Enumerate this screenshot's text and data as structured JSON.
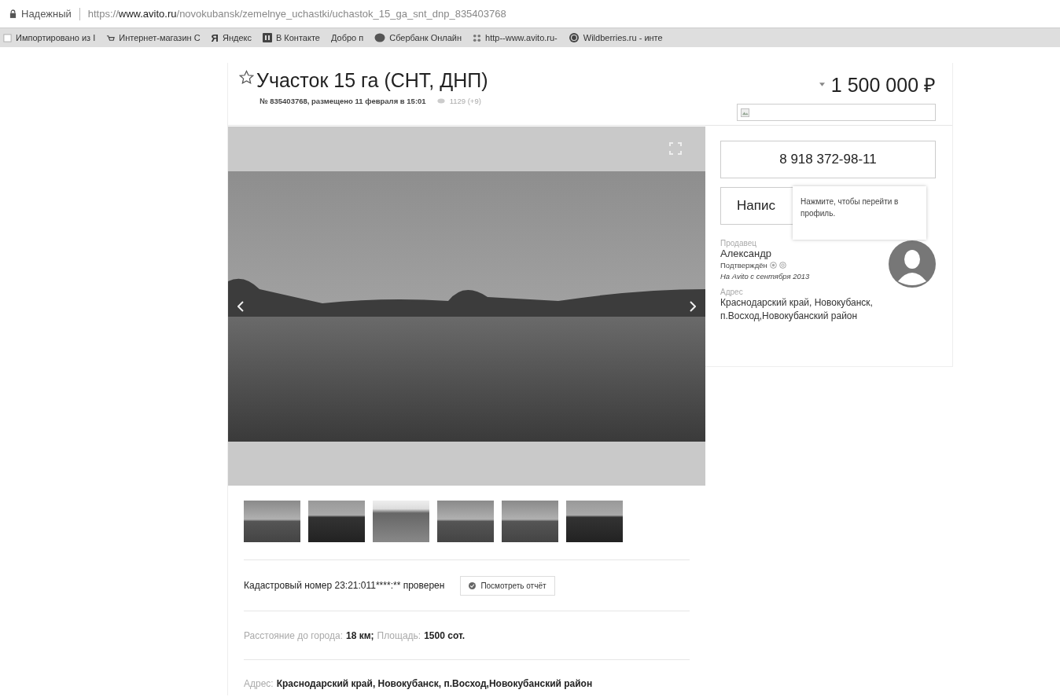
{
  "browser": {
    "security_label": "Надежный",
    "url": {
      "scheme": "https://",
      "host": "www.avito.ru",
      "path": "/novokubansk/zemelnye_uchastki/uchastok_15_ga_snt_dnp_835403768"
    }
  },
  "bookmarks": [
    {
      "kind": "blank",
      "label": "Импортировано из I"
    },
    {
      "kind": "page",
      "label": "Интернет-магазин С"
    },
    {
      "kind": "letter",
      "icon": "Я",
      "label": "Яндекс"
    },
    {
      "kind": "tile",
      "label": "В Контакте"
    },
    {
      "kind": "none",
      "label": "Добро п"
    },
    {
      "kind": "round",
      "label": "Сбербанк Онлайн"
    },
    {
      "kind": "dots",
      "label": "http--www.avito.ru-"
    },
    {
      "kind": "ring",
      "label": "Wildberries.ru - инте"
    }
  ],
  "listing": {
    "title": "Участок 15 га (СНТ, ДНП)",
    "favorite": false,
    "meta": "№ 835403768, размещено 11 февраля в 15:01",
    "views": "1129 (+9)"
  },
  "gallery": {
    "thumbnails": [
      {
        "kind": "meadow"
      },
      {
        "kind": "dark"
      },
      {
        "kind": "road"
      },
      {
        "kind": "meadow"
      },
      {
        "kind": "meadow"
      },
      {
        "kind": "dark"
      }
    ]
  },
  "cadastre": {
    "text": "Кадастровый номер 23:21:011****:** проверен",
    "button": "Посмотреть отчёт"
  },
  "params": [
    {
      "label": "Расстояние до города:",
      "value": "18 км;"
    },
    {
      "label": "Площадь:",
      "value": "1500 сот."
    }
  ],
  "address_row": {
    "label": "Адрес:",
    "value": "Краснодарский край, Новокубанск, п.Восход,Новокубанский район"
  },
  "sidebar": {
    "price": "1 500 000 ₽",
    "phone_button": "8 918 372-98-11",
    "write_button": "Напис",
    "tooltip": "Нажмите, чтобы перейти в профиль.",
    "seller_label": "Продавец",
    "seller_name": "Александр",
    "verified": "Подтверждён",
    "since": "На Avito с сентября 2013",
    "address_label": "Адрес",
    "address": "Краснодарский край, Новокубанск, п.Восход,Новокубанский район"
  }
}
